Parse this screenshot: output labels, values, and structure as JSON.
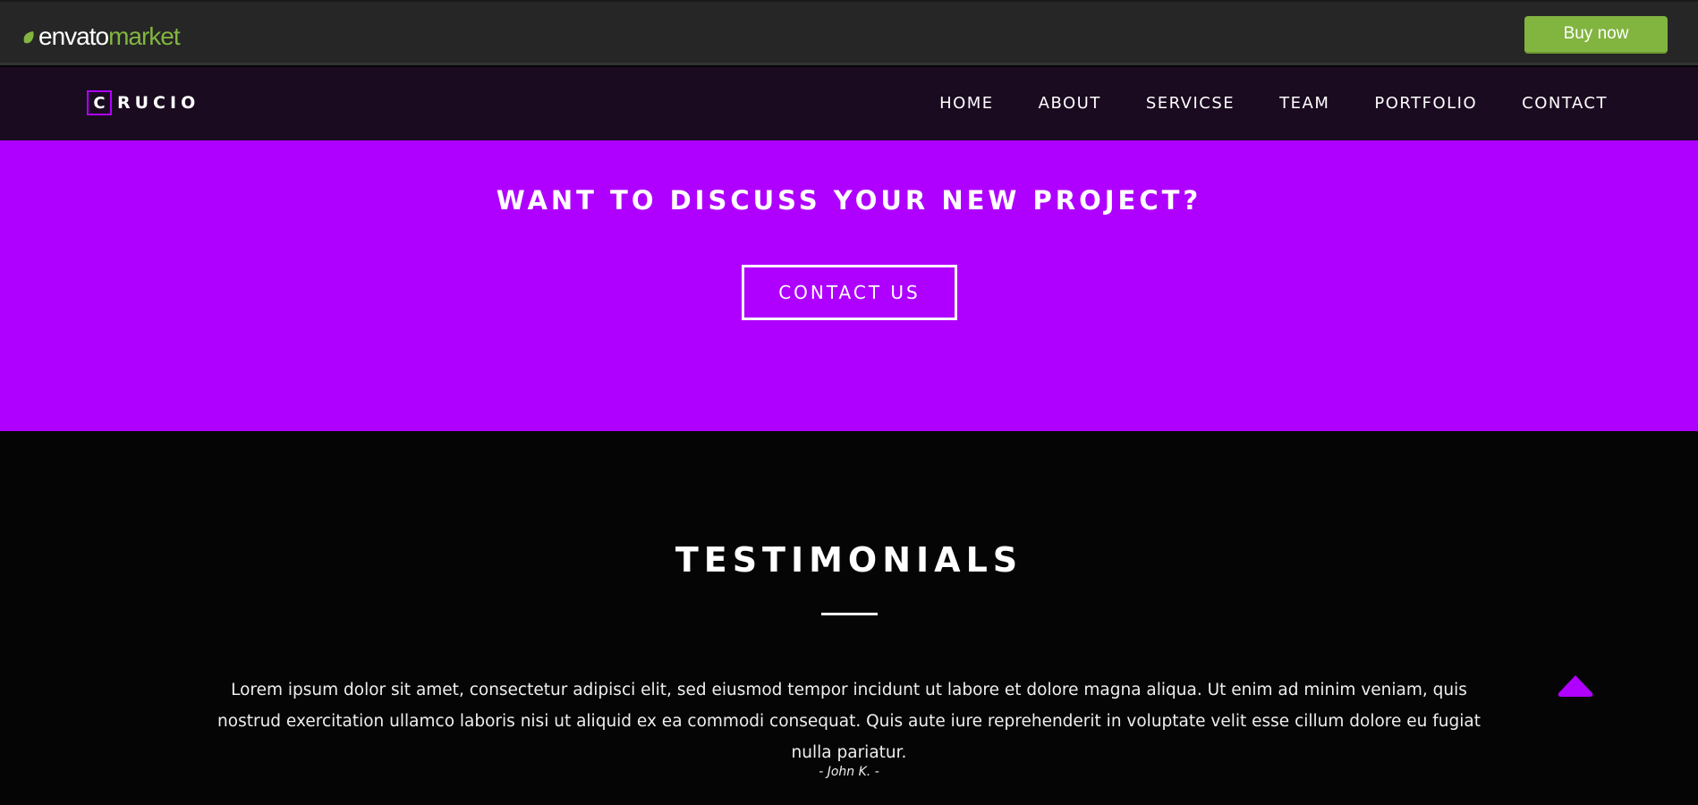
{
  "envato_bar": {
    "logo_envato": "envato",
    "logo_market": "market",
    "buy_label": "Buy now",
    "accent_color": "#82b440"
  },
  "nav": {
    "brand_initial": "C",
    "brand_rest": "RUCIO",
    "links": [
      {
        "label": "HOME"
      },
      {
        "label": "ABOUT"
      },
      {
        "label": "SERVICSE"
      },
      {
        "label": "TEAM"
      },
      {
        "label": "PORTFOLIO"
      },
      {
        "label": "CONTACT"
      }
    ],
    "brand_color": "#af00ff"
  },
  "cta": {
    "title": "WANT TO DISCUSS YOUR NEW PROJECT?",
    "button_label": "CONTACT US",
    "background": "#af00ff"
  },
  "testimonials": {
    "title": "TESTIMONIALS",
    "quote": "Lorem ipsum dolor sit amet, consectetur adipisci elit, sed eiusmod tempor incidunt ut labore et dolore magna aliqua. Ut enim ad minim veniam, quis nostrud exercitation ullamco laboris nisi ut aliquid ex ea commodi consequat. Quis aute iure reprehenderit in voluptate velit esse cillum dolore eu fugiat nulla pariatur.",
    "author": "- John K. -"
  },
  "scroll_top": {
    "icon": "arrow-up-icon"
  }
}
